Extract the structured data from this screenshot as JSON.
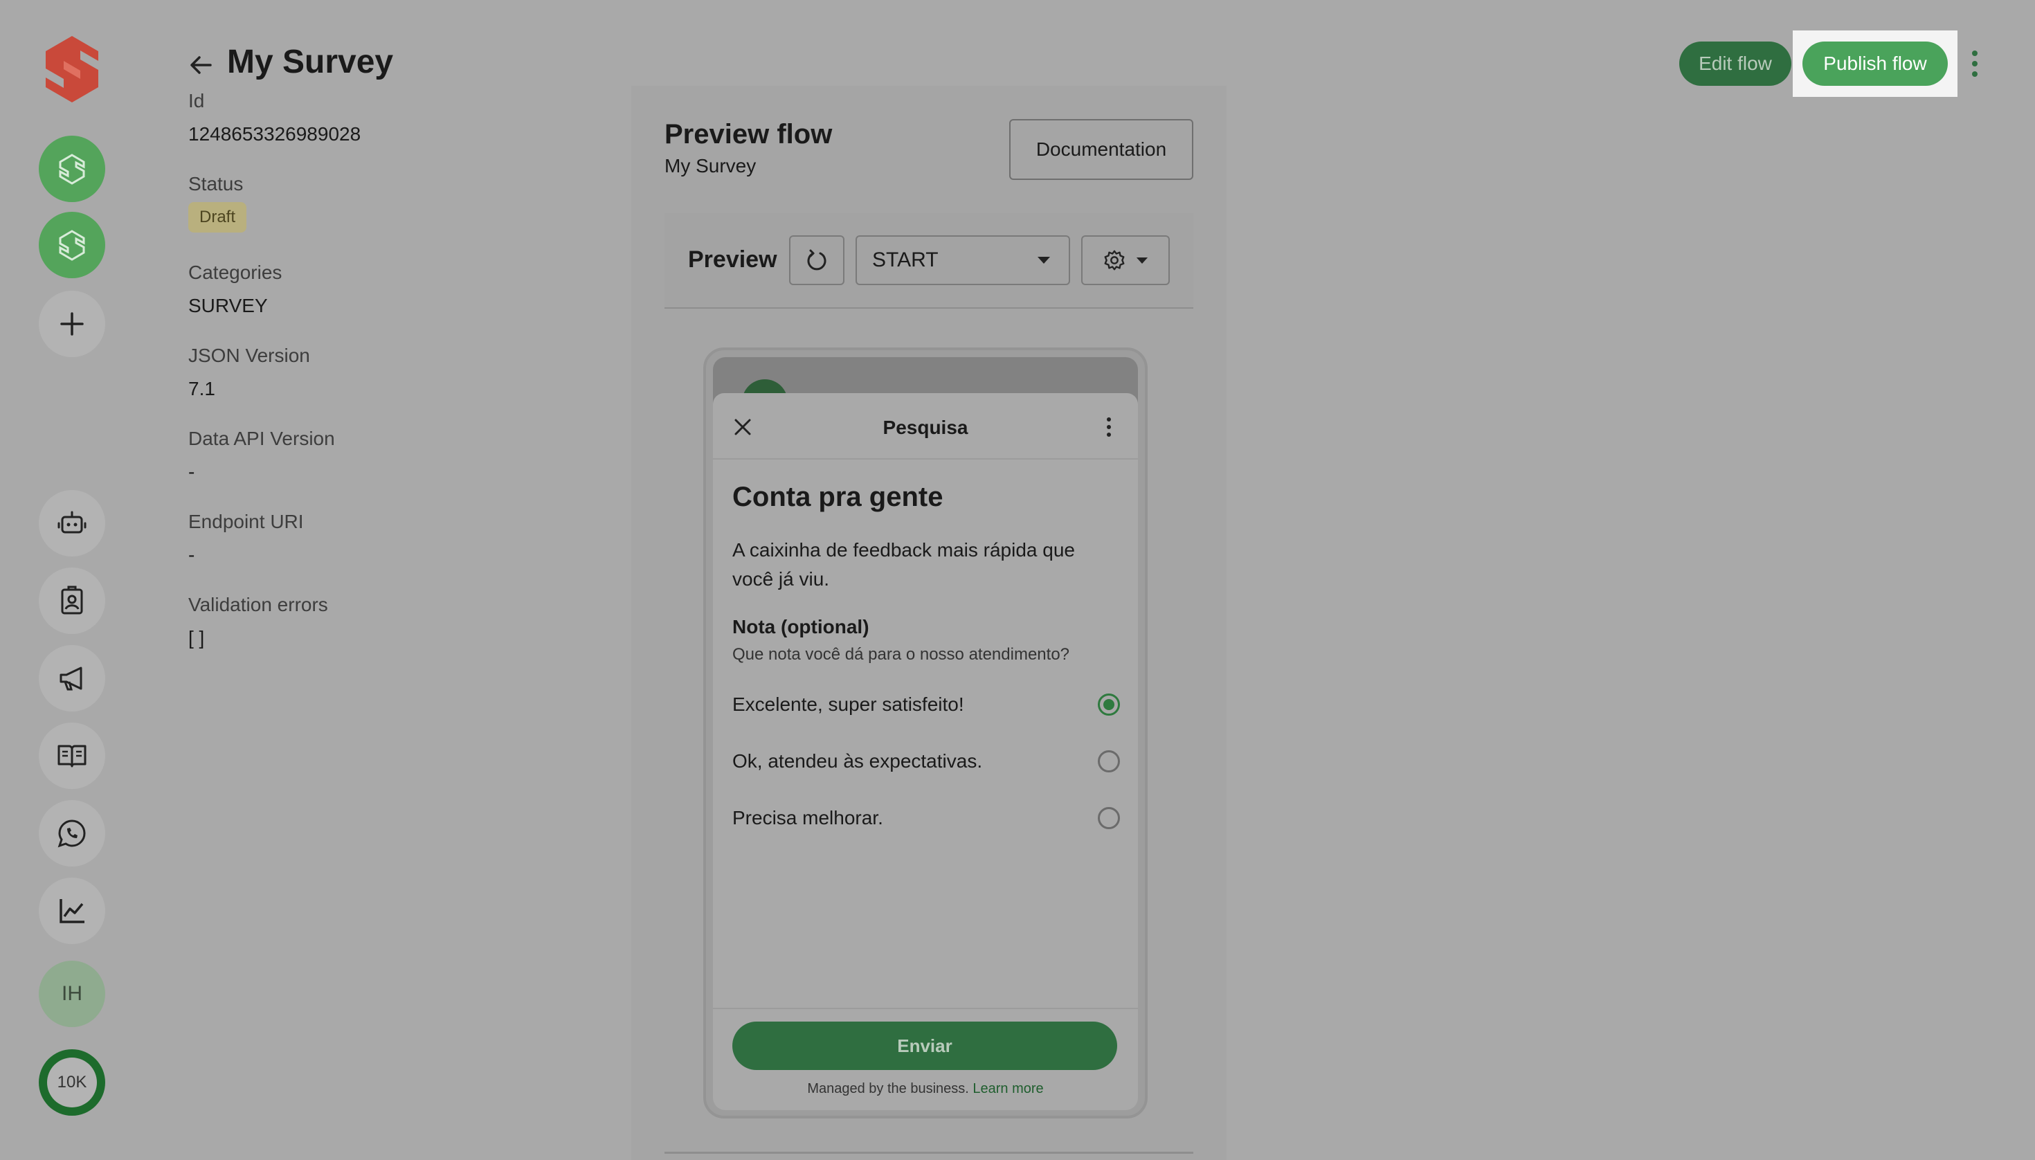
{
  "colors": {
    "brand_logo": "#d65a4a",
    "accent_green": "#4aa35b",
    "dark_green": "#2f6e40",
    "draft_badge": "#b9b07e",
    "overlay": "#a9a9a9"
  },
  "sidebar": {
    "items": [
      {
        "icon": "brand-logo-icon"
      },
      {
        "icon": "workspace-logo-icon"
      },
      {
        "icon": "workspace-logo-icon"
      },
      {
        "icon": "plus-icon"
      },
      {
        "icon": "bot-icon"
      },
      {
        "icon": "contact-badge-icon"
      },
      {
        "icon": "megaphone-icon"
      },
      {
        "icon": "book-icon"
      },
      {
        "icon": "whatsapp-icon"
      },
      {
        "icon": "chart-line-icon"
      }
    ],
    "avatar_initials": "IH",
    "credit_label": "10K"
  },
  "header": {
    "title": "My Survey",
    "edit_label": "Edit flow",
    "publish_label": "Publish flow"
  },
  "info": {
    "id_label": "Id",
    "id_value": "1248653326989028",
    "status_label": "Status",
    "status_value": "Draft",
    "categories_label": "Categories",
    "categories_value": "SURVEY",
    "json_version_label": "JSON Version",
    "json_version_value": "7.1",
    "data_api_label": "Data API Version",
    "data_api_value": "-",
    "endpoint_label": "Endpoint URI",
    "endpoint_value": "-",
    "validation_label": "Validation errors",
    "validation_value": "[ ]"
  },
  "preview": {
    "title": "Preview flow",
    "subtitle": "My Survey",
    "documentation_label": "Documentation",
    "bar_label": "Preview",
    "screen_select": "START"
  },
  "phone": {
    "sheet_title": "Pesquisa",
    "heading": "Conta pra gente",
    "body": "A caixinha de feedback mais rápida que você já viu.",
    "question_label": "Nota (optional)",
    "question_help": "Que nota você dá para o nosso atendimento?",
    "options": [
      {
        "label": "Excelente, super satisfeito!",
        "selected": true
      },
      {
        "label": "Ok, atendeu às expectativas.",
        "selected": false
      },
      {
        "label": "Precisa melhorar.",
        "selected": false
      }
    ],
    "submit_label": "Enviar",
    "managed_text": "Managed by the business.",
    "learn_more": "Learn more"
  }
}
